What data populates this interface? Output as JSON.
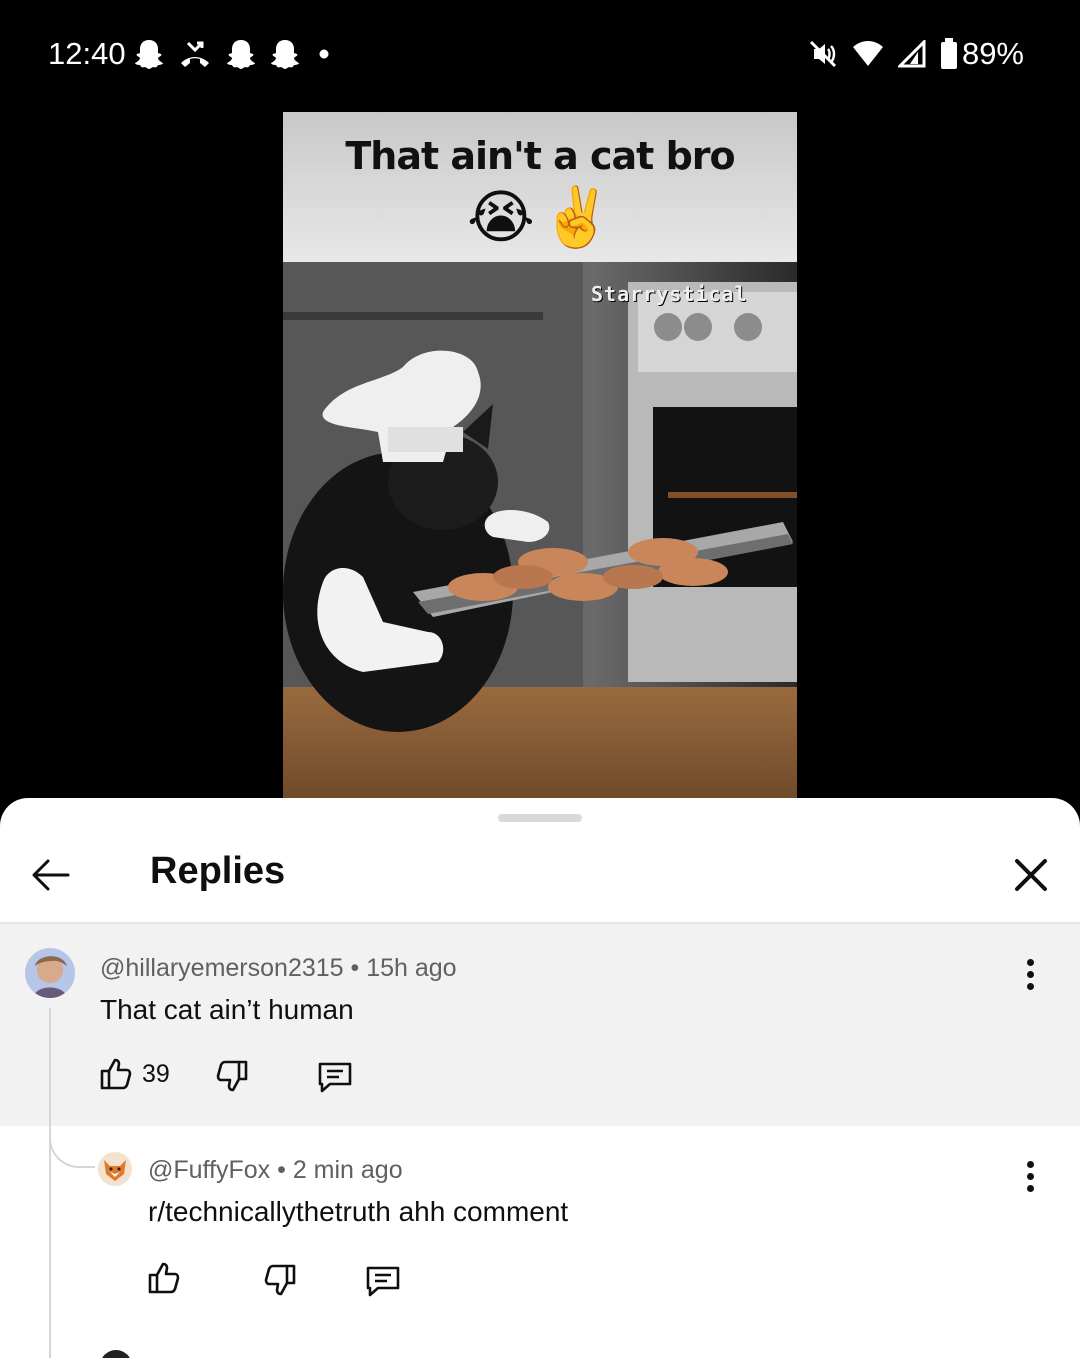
{
  "status_bar": {
    "time": "12:40",
    "battery_percent": "89%",
    "left_icons": [
      "snapchat-icon",
      "missed-call-icon",
      "snapchat-icon",
      "snapchat-icon",
      "dot-icon"
    ],
    "right_icons": [
      "mute-icon",
      "wifi-icon",
      "signal-icon",
      "battery-icon"
    ]
  },
  "video": {
    "caption": "That ain't a cat bro",
    "caption_emojis": [
      "😭",
      "✌️"
    ],
    "watermark": "Starrystical"
  },
  "sheet": {
    "title": "Replies",
    "back_icon": "arrow-left-icon",
    "close_icon": "close-icon"
  },
  "comments": [
    {
      "handle": "@hillaryemerson2315",
      "time": "15h ago",
      "text": "That cat ain’t human",
      "likes": "39"
    },
    {
      "handle": "@FuffyFox",
      "time": "2 min ago",
      "text": "r/technicallythetruth ahh comment",
      "likes": ""
    }
  ],
  "colors": {
    "sheet_bg": "#ffffff",
    "highlight_bg": "#f2f2f2",
    "meta_text": "#606060",
    "primary_text": "#0f0f0f"
  }
}
